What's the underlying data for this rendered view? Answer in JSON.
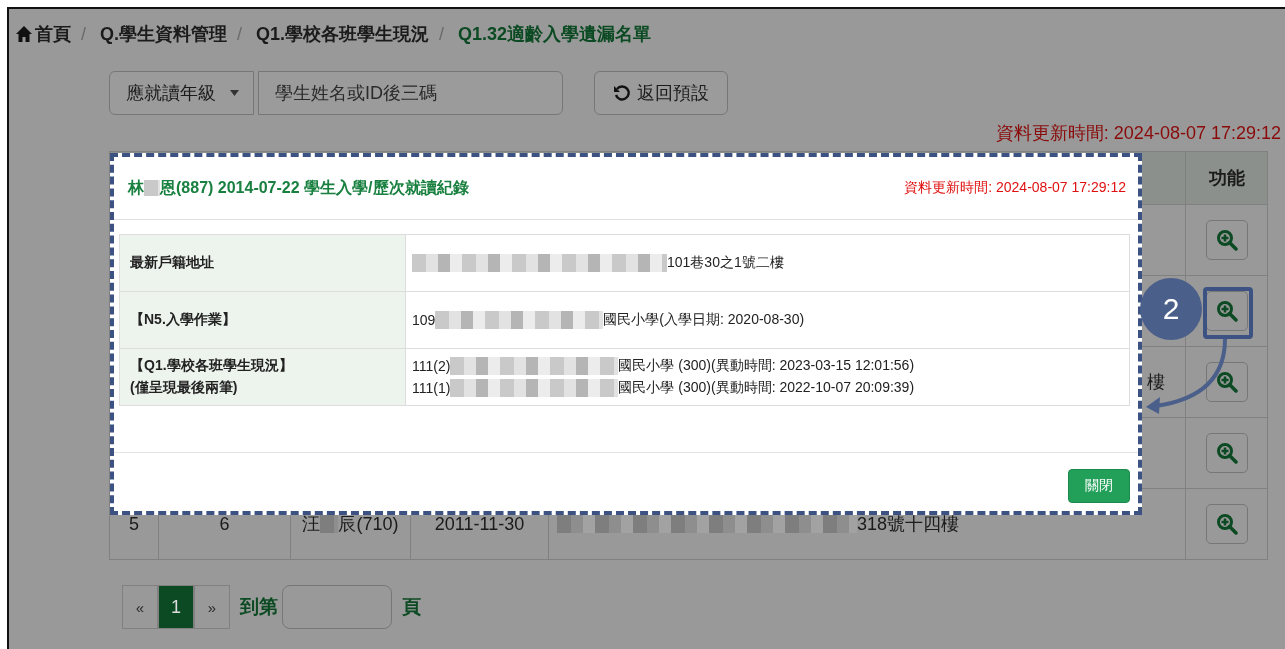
{
  "breadcrumb": [
    {
      "label": "首頁",
      "separator": "/",
      "selected": false
    },
    {
      "label": "Q.學生資料管理",
      "separator": "/",
      "selected": false
    },
    {
      "label": "Q1.學校各班學生現況",
      "separator": "/",
      "selected": false
    },
    {
      "label": "Q1.32適齡入學遺漏名單",
      "selected": true
    }
  ],
  "filters": {
    "grade_select": {
      "value": "應就讀年級"
    },
    "search": {
      "placeholder": "學生姓名或ID後三碼"
    },
    "reset_button": {
      "label": "返回預設"
    }
  },
  "update_time": "資料更新時間: 2024-08-07 17:29:12",
  "table": {
    "columns": [
      {
        "label": "功能"
      }
    ],
    "rows": [
      {
        "action": {
          "highlighted": false
        }
      },
      {
        "action": {
          "highlighted": true
        }
      },
      {
        "column_5": "樓",
        "action": {
          "highlighted": false
        }
      },
      {
        "action": {
          "highlighted": false
        }
      },
      {
        "column_1": "5",
        "column_2": "6",
        "column_3": {
          "before": "汪",
          "after": "辰(710)"
        },
        "column_4": "2011-11-30",
        "column_5": {
          "redacted": true,
          "after": "318號十四樓"
        },
        "action": {
          "highlighted": false
        }
      }
    ]
  },
  "pagination": {
    "prev": "«",
    "pages": [
      {
        "label": "1",
        "selected": true
      }
    ],
    "next": "»",
    "goto_prefix": "到第",
    "goto_suffix": "頁"
  },
  "dialog": {
    "title": {
      "before": "林",
      "after": "恩(887) 2014-07-22 學生入學/歷次就讀紀錄"
    },
    "update_time": "資料更新時間: 2024-08-07 17:29:12",
    "rows": [
      {
        "label_lines": [
          "最新戶籍地址"
        ],
        "lines": [
          {
            "redacted": true,
            "after": "101巷30之1號二樓"
          }
        ]
      },
      {
        "label_lines": [
          "【N5.入學作業】"
        ],
        "lines": [
          {
            "before": "109",
            "redacted": true,
            "after": "國民小學(入學日期: 2020-08-30)"
          }
        ]
      },
      {
        "label_lines": [
          "【Q1.學校各班學生現況】",
          "(僅呈現最後兩筆)"
        ],
        "lines": [
          {
            "before": "111(2)",
            "redacted": true,
            "after": "國民小學 (300)(異動時間: 2023-03-15 12:01:56)"
          },
          {
            "before": "111(1)",
            "redacted": true,
            "after": "國民小學 (300)(異動時間: 2022-10-07 20:09:39)"
          }
        ]
      }
    ],
    "close_button": "關閉"
  },
  "annotation": {
    "badge": "2"
  }
}
